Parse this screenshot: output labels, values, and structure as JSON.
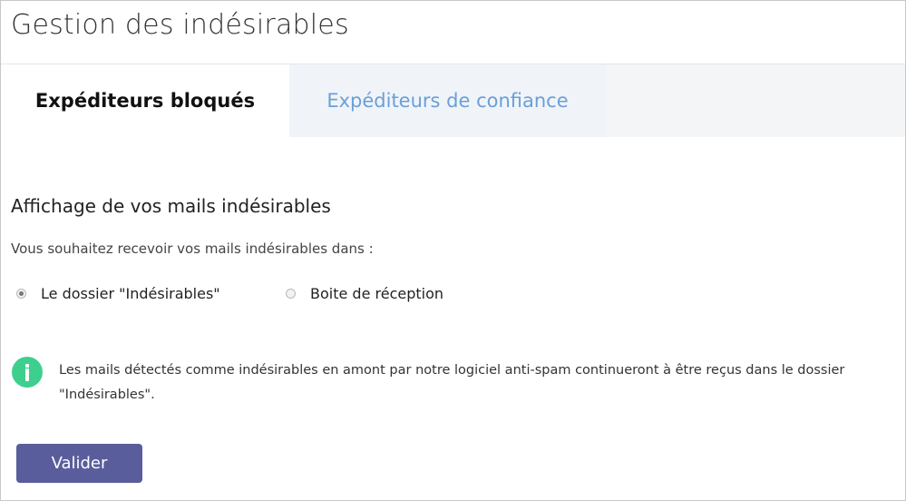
{
  "page": {
    "title": "Gestion des indésirables"
  },
  "tabs": [
    {
      "label": "Expéditeurs bloqués",
      "active": true
    },
    {
      "label": "Expéditeurs de confiance",
      "active": false
    }
  ],
  "section": {
    "title": "Affichage de vos mails indésirables",
    "question": "Vous souhaitez recevoir vos mails indésirables dans :"
  },
  "options": [
    {
      "label": "Le dossier \"Indésirables\"",
      "checked": true
    },
    {
      "label": "Boite de réception",
      "checked": false
    }
  ],
  "info": {
    "icon": "info-icon",
    "text": "Les mails détectés comme indésirables en amont par notre logiciel anti-spam continueront à être reçus dans le dossier \"Indésirables\"."
  },
  "actions": {
    "submit_label": "Valider"
  },
  "colors": {
    "accent_button": "#5a5d9b",
    "info_green": "#3ecf8e",
    "inactive_tab_text": "#6a9fd8"
  }
}
